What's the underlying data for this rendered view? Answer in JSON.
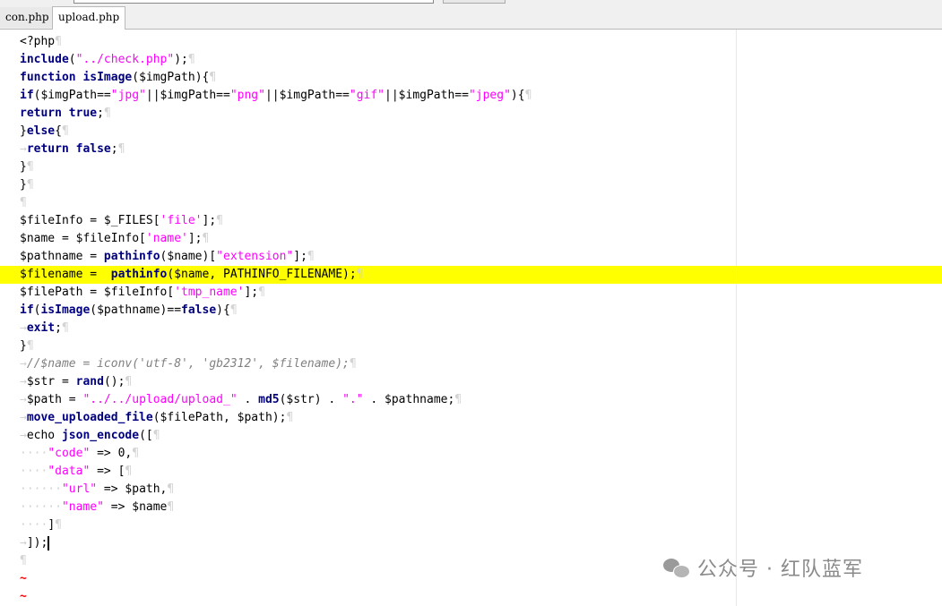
{
  "tabs": [
    {
      "label": "con.php",
      "active": false
    },
    {
      "label": "upload.php",
      "active": true
    }
  ],
  "highlight_color": "#ffff00",
  "code": [
    [
      [
        "t",
        "<?php"
      ],
      [
        "p",
        "¶"
      ]
    ],
    [
      [
        "k",
        "include"
      ],
      [
        "t",
        "("
      ],
      [
        "s",
        "\"../check.php\""
      ],
      [
        "t",
        ");"
      ],
      [
        "p",
        "¶"
      ]
    ],
    [
      [
        "k",
        "function"
      ],
      [
        "t",
        " "
      ],
      [
        "k",
        "isImage"
      ],
      [
        "t",
        "($imgPath){"
      ],
      [
        "p",
        "¶"
      ]
    ],
    [
      [
        "k",
        "if"
      ],
      [
        "t",
        "($imgPath=="
      ],
      [
        "s",
        "\"jpg\""
      ],
      [
        "t",
        "||$imgPath=="
      ],
      [
        "s",
        "\"png\""
      ],
      [
        "t",
        "||$imgPath=="
      ],
      [
        "s",
        "\"gif\""
      ],
      [
        "t",
        "||$imgPath=="
      ],
      [
        "s",
        "\"jpeg\""
      ],
      [
        "t",
        "){"
      ],
      [
        "p",
        "¶"
      ]
    ],
    [
      [
        "k",
        "return"
      ],
      [
        "t",
        " "
      ],
      [
        "k",
        "true"
      ],
      [
        "t",
        ";"
      ],
      [
        "p",
        "¶"
      ]
    ],
    [
      [
        "t",
        "}"
      ],
      [
        "k",
        "else"
      ],
      [
        "t",
        "{"
      ],
      [
        "p",
        "¶"
      ]
    ],
    [
      [
        "d",
        "→"
      ],
      [
        "k",
        "return"
      ],
      [
        "t",
        " "
      ],
      [
        "k",
        "false"
      ],
      [
        "t",
        ";"
      ],
      [
        "p",
        "¶"
      ]
    ],
    [
      [
        "t",
        "}"
      ],
      [
        "p",
        "¶"
      ]
    ],
    [
      [
        "t",
        "}"
      ],
      [
        "p",
        "¶"
      ]
    ],
    [
      [
        "p",
        "¶"
      ]
    ],
    [
      [
        "t",
        "$fileInfo = $_FILES["
      ],
      [
        "s",
        "'file'"
      ],
      [
        "t",
        "];"
      ],
      [
        "p",
        "¶"
      ]
    ],
    [
      [
        "t",
        "$name = $fileInfo["
      ],
      [
        "s",
        "'name'"
      ],
      [
        "t",
        "];"
      ],
      [
        "p",
        "¶"
      ]
    ],
    [
      [
        "t",
        "$pathname = "
      ],
      [
        "k",
        "pathinfo"
      ],
      [
        "t",
        "($name)["
      ],
      [
        "s",
        "\"extension\""
      ],
      [
        "t",
        "];"
      ],
      [
        "p",
        "¶"
      ]
    ],
    [
      [
        "t",
        "$filename =  "
      ],
      [
        "k",
        "pathinfo"
      ],
      [
        "t",
        "($name, PATHINFO_FILENAME);"
      ],
      [
        "p",
        "¶"
      ]
    ],
    [
      [
        "t",
        "$filePath = $fileInfo["
      ],
      [
        "s",
        "'tmp_name'"
      ],
      [
        "t",
        "];"
      ],
      [
        "p",
        "¶"
      ]
    ],
    [
      [
        "k",
        "if"
      ],
      [
        "t",
        "("
      ],
      [
        "k",
        "isImage"
      ],
      [
        "t",
        "($pathname)=="
      ],
      [
        "k",
        "false"
      ],
      [
        "t",
        "){"
      ],
      [
        "p",
        "¶"
      ]
    ],
    [
      [
        "d",
        "→"
      ],
      [
        "k",
        "exit"
      ],
      [
        "t",
        ";"
      ],
      [
        "p",
        "¶"
      ]
    ],
    [
      [
        "t",
        "}"
      ],
      [
        "p",
        "¶"
      ]
    ],
    [
      [
        "d",
        "→"
      ],
      [
        "c",
        "//$name = iconv('utf-8', 'gb2312', $filename);"
      ],
      [
        "p",
        "¶"
      ]
    ],
    [
      [
        "d",
        "→"
      ],
      [
        "t",
        "$str = "
      ],
      [
        "k",
        "rand"
      ],
      [
        "t",
        "();"
      ],
      [
        "p",
        "¶"
      ]
    ],
    [
      [
        "d",
        "→"
      ],
      [
        "t",
        "$path = "
      ],
      [
        "s",
        "\"../../upload/upload_\""
      ],
      [
        "t",
        " . "
      ],
      [
        "k",
        "md5"
      ],
      [
        "t",
        "($str) . "
      ],
      [
        "s",
        "\".\""
      ],
      [
        "t",
        " . $pathname;"
      ],
      [
        "p",
        "¶"
      ]
    ],
    [
      [
        "d",
        "→"
      ],
      [
        "k",
        "move_uploaded_file"
      ],
      [
        "t",
        "($filePath, $path);"
      ],
      [
        "p",
        "¶"
      ]
    ],
    [
      [
        "d",
        "→"
      ],
      [
        "t",
        "echo "
      ],
      [
        "k",
        "json_encode"
      ],
      [
        "t",
        "(["
      ],
      [
        "p",
        "¶"
      ]
    ],
    [
      [
        "d",
        "····"
      ],
      [
        "s",
        "\"code\""
      ],
      [
        "t",
        " => 0,"
      ],
      [
        "p",
        "¶"
      ]
    ],
    [
      [
        "d",
        "····"
      ],
      [
        "s",
        "\"data\""
      ],
      [
        "t",
        " => ["
      ],
      [
        "p",
        "¶"
      ]
    ],
    [
      [
        "d",
        "······"
      ],
      [
        "s",
        "\"url\""
      ],
      [
        "t",
        " => $path,"
      ],
      [
        "p",
        "¶"
      ]
    ],
    [
      [
        "d",
        "······"
      ],
      [
        "s",
        "\"name\""
      ],
      [
        "t",
        " => $name"
      ],
      [
        "p",
        "¶"
      ]
    ],
    [
      [
        "d",
        "····"
      ],
      [
        "t",
        "]"
      ],
      [
        "p",
        "¶"
      ]
    ],
    [
      [
        "d",
        "→"
      ],
      [
        "t",
        "]);"
      ],
      [
        "x",
        ""
      ]
    ],
    [
      [
        "p",
        "¶"
      ]
    ],
    [
      [
        "r",
        "~"
      ]
    ],
    [
      [
        "r",
        "~"
      ]
    ]
  ],
  "highlighted_line": 13,
  "watermark": "公众号 · 红队蓝军"
}
